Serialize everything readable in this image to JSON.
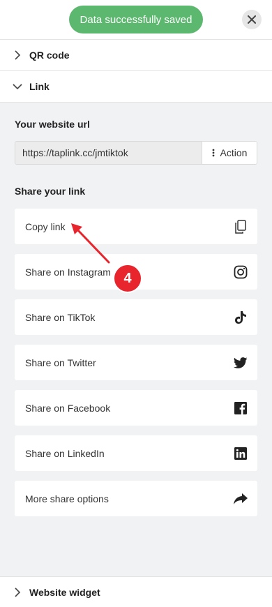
{
  "toast": {
    "message": "Data successfully saved"
  },
  "sections": {
    "qr_code": "QR code",
    "link": "Link",
    "website_widget": "Website widget"
  },
  "url": {
    "title": "Your website url",
    "value": "https://taplink.cc/jmtiktok",
    "action_label": "Action"
  },
  "share": {
    "title": "Share your link",
    "items": [
      {
        "label": "Copy link",
        "icon": "copy-icon"
      },
      {
        "label": "Share on Instagram",
        "icon": "instagram-icon"
      },
      {
        "label": "Share on TikTok",
        "icon": "tiktok-icon"
      },
      {
        "label": "Share on Twitter",
        "icon": "twitter-icon"
      },
      {
        "label": "Share on Facebook",
        "icon": "facebook-icon"
      },
      {
        "label": "Share on LinkedIn",
        "icon": "linkedin-icon"
      },
      {
        "label": "More share options",
        "icon": "share-forward-icon"
      }
    ]
  },
  "annotation": {
    "step": "4",
    "color": "#e8242d"
  },
  "colors": {
    "toast": "#5cb86f",
    "background": "#f1f2f4"
  }
}
